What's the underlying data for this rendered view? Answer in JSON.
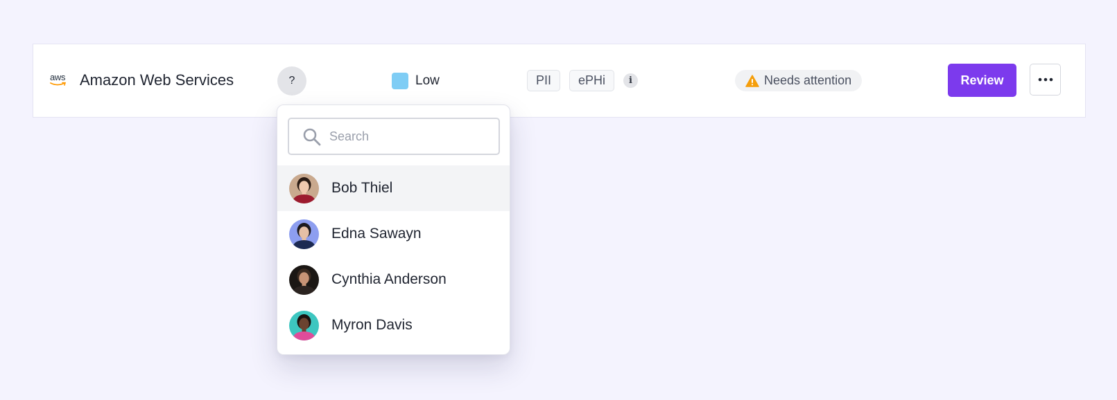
{
  "vendor": {
    "logo_text": "aws",
    "name": "Amazon Web Services"
  },
  "owner_button": {
    "label": "?"
  },
  "risk": {
    "label": "Low",
    "color": "#7fcdf5"
  },
  "tags": [
    {
      "label": "PII"
    },
    {
      "label": "ePHi"
    }
  ],
  "info_icon": {
    "glyph": "i"
  },
  "status": {
    "label": "Needs attention",
    "icon": "warning-icon",
    "icon_color": "#f59e0b"
  },
  "actions": {
    "review_label": "Review",
    "review_color": "#7c3aed",
    "more_icon": "more-horizontal-icon"
  },
  "owner_dropdown": {
    "search": {
      "placeholder": "Search",
      "value": ""
    },
    "users": [
      {
        "name": "Bob Thiel",
        "highlighted": true,
        "avatar_bg": "#c9a98e",
        "avatar_shirt": "#9c1a2e",
        "avatar_skin": "#f0c9ae",
        "avatar_hair": "#2a1b14"
      },
      {
        "name": "Edna Sawayn",
        "highlighted": false,
        "avatar_bg": "#8d9ef0",
        "avatar_shirt": "#1c2a52",
        "avatar_skin": "#e6c0a6",
        "avatar_hair": "#1d1a1f"
      },
      {
        "name": "Cynthia Anderson",
        "highlighted": false,
        "avatar_bg": "#1b1714",
        "avatar_shirt": "#2b2320",
        "avatar_skin": "#c89476",
        "avatar_hair": "#3a2a20"
      },
      {
        "name": "Myron Davis",
        "highlighted": false,
        "avatar_bg": "#3dc6c0",
        "avatar_shirt": "#e04c9a",
        "avatar_skin": "#6b4330",
        "avatar_hair": "#1a1210"
      }
    ]
  }
}
